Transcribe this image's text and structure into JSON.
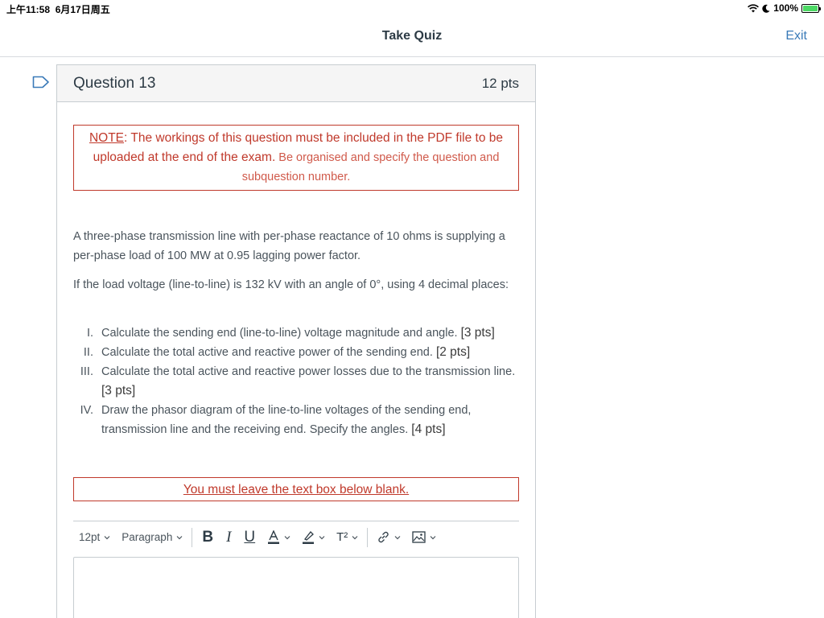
{
  "status": {
    "time": "上午11:58",
    "date": "6月17日周五",
    "battery": "100%"
  },
  "nav": {
    "title": "Take Quiz",
    "exit_label": "Exit"
  },
  "question": {
    "title": "Question 13",
    "points": "12 pts",
    "note_label": "NOTE",
    "note_text": ": The workings of this question must be included in the PDF file to be uploaded at the end of the exam.",
    "note_text_light": " Be organised and specify the question and subquestion number.",
    "paragraph1": "A three-phase transmission line with per-phase reactance of 10 ohms is supplying a per-phase load of 100 MW at 0.95 lagging power factor.",
    "paragraph2": "If the load voltage (line-to-line) is 132 kV with an angle of 0°, using 4 decimal places:",
    "subquestions": [
      {
        "num": "I.",
        "text": "Calculate the sending end (line-to-line) voltage magnitude and angle.",
        "pts": "[3 pts]"
      },
      {
        "num": "II.",
        "text": "Calculate the total active and reactive power of the sending end.",
        "pts": "[2 pts]"
      },
      {
        "num": "III.",
        "text": "Calculate the total active and reactive power losses due to the transmission line.",
        "pts": "[3 pts]"
      },
      {
        "num": "IV.",
        "text": "Draw the phasor diagram of the line-to-line voltages of the sending end, transmission line and the receiving end. Specify the angles.",
        "pts": "[4 pts]"
      }
    ],
    "warning": "You must leave the text box below blank."
  },
  "editor": {
    "font_size": "12pt",
    "block_format": "Paragraph",
    "bold": "B",
    "italic": "I",
    "underline": "U",
    "text_color": "A",
    "superscript": "T²"
  },
  "colors": {
    "accent": "#3a7ab8",
    "warning": "#c0392b"
  }
}
